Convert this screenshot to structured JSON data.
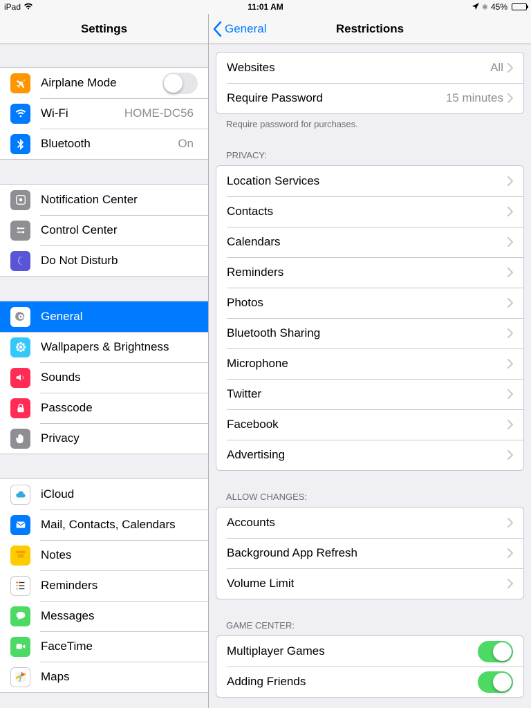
{
  "statusbar": {
    "device": "iPad",
    "time": "11:01 AM",
    "battery": "45%"
  },
  "sidebar": {
    "title": "Settings",
    "groups": [
      {
        "items": [
          {
            "id": "airplane",
            "label": "Airplane Mode",
            "icon": "#ff9500",
            "glyph": "plane",
            "toggle": true,
            "on": false
          },
          {
            "id": "wifi",
            "label": "Wi-Fi",
            "icon": "#007aff",
            "glyph": "wifi",
            "value": "HOME-DC56"
          },
          {
            "id": "bluetooth",
            "label": "Bluetooth",
            "icon": "#007aff",
            "glyph": "bluetooth",
            "value": "On"
          }
        ]
      },
      {
        "items": [
          {
            "id": "notification",
            "label": "Notification Center",
            "icon": "#8e8e93",
            "glyph": "notif"
          },
          {
            "id": "controlcenter",
            "label": "Control Center",
            "icon": "#8e8e93",
            "glyph": "cc"
          },
          {
            "id": "dnd",
            "label": "Do Not Disturb",
            "icon": "#5856d6",
            "glyph": "moon"
          }
        ]
      },
      {
        "items": [
          {
            "id": "general",
            "label": "General",
            "icon": "#8e8e93",
            "glyph": "gear",
            "selected": true
          },
          {
            "id": "wallpapers",
            "label": "Wallpapers & Brightness",
            "icon": "#34c8fa",
            "glyph": "flower"
          },
          {
            "id": "sounds",
            "label": "Sounds",
            "icon": "#ff2d55",
            "glyph": "sound"
          },
          {
            "id": "passcode",
            "label": "Passcode",
            "icon": "#ff2d55",
            "glyph": "lock"
          },
          {
            "id": "privacy",
            "label": "Privacy",
            "icon": "#8e8e93",
            "glyph": "hand"
          }
        ]
      },
      {
        "items": [
          {
            "id": "icloud",
            "label": "iCloud",
            "icon": "#ffffff",
            "glyph": "cloud",
            "iconBorder": true
          },
          {
            "id": "mail",
            "label": "Mail, Contacts, Calendars",
            "icon": "#007aff",
            "glyph": "mail"
          },
          {
            "id": "notes",
            "label": "Notes",
            "icon": "#ffcc00",
            "glyph": "notes"
          },
          {
            "id": "reminders",
            "label": "Reminders",
            "icon": "#ffffff",
            "glyph": "reminders",
            "iconBorder": true
          },
          {
            "id": "messages",
            "label": "Messages",
            "icon": "#4cd964",
            "glyph": "msg"
          },
          {
            "id": "facetime",
            "label": "FaceTime",
            "icon": "#4cd964",
            "glyph": "video"
          },
          {
            "id": "maps",
            "label": "Maps",
            "icon": "#ffffff",
            "glyph": "maps",
            "iconBorder": true
          }
        ]
      }
    ]
  },
  "content": {
    "back": "General",
    "title": "Restrictions",
    "groups": [
      {
        "header": "",
        "footer": "Require password for purchases.",
        "items": [
          {
            "id": "websites",
            "label": "Websites",
            "value": "All",
            "disclosure": true
          },
          {
            "id": "reqpass",
            "label": "Require Password",
            "value": "15 minutes",
            "disclosure": true
          }
        ]
      },
      {
        "header": "PRIVACY:",
        "items": [
          {
            "id": "loc",
            "label": "Location Services",
            "disclosure": true
          },
          {
            "id": "contacts",
            "label": "Contacts",
            "disclosure": true
          },
          {
            "id": "cal",
            "label": "Calendars",
            "disclosure": true
          },
          {
            "id": "rem",
            "label": "Reminders",
            "disclosure": true
          },
          {
            "id": "photos",
            "label": "Photos",
            "disclosure": true
          },
          {
            "id": "btshare",
            "label": "Bluetooth Sharing",
            "disclosure": true
          },
          {
            "id": "mic",
            "label": "Microphone",
            "disclosure": true
          },
          {
            "id": "twitter",
            "label": "Twitter",
            "disclosure": true
          },
          {
            "id": "fb",
            "label": "Facebook",
            "disclosure": true
          },
          {
            "id": "ads",
            "label": "Advertising",
            "disclosure": true
          }
        ]
      },
      {
        "header": "ALLOW CHANGES:",
        "items": [
          {
            "id": "accounts",
            "label": "Accounts",
            "disclosure": true
          },
          {
            "id": "bgapp",
            "label": "Background App Refresh",
            "disclosure": true
          },
          {
            "id": "vol",
            "label": "Volume Limit",
            "disclosure": true
          }
        ]
      },
      {
        "header": "GAME CENTER:",
        "items": [
          {
            "id": "multi",
            "label": "Multiplayer Games",
            "toggle": true,
            "on": true
          },
          {
            "id": "friends",
            "label": "Adding Friends",
            "toggle": true,
            "on": true
          }
        ]
      }
    ]
  }
}
